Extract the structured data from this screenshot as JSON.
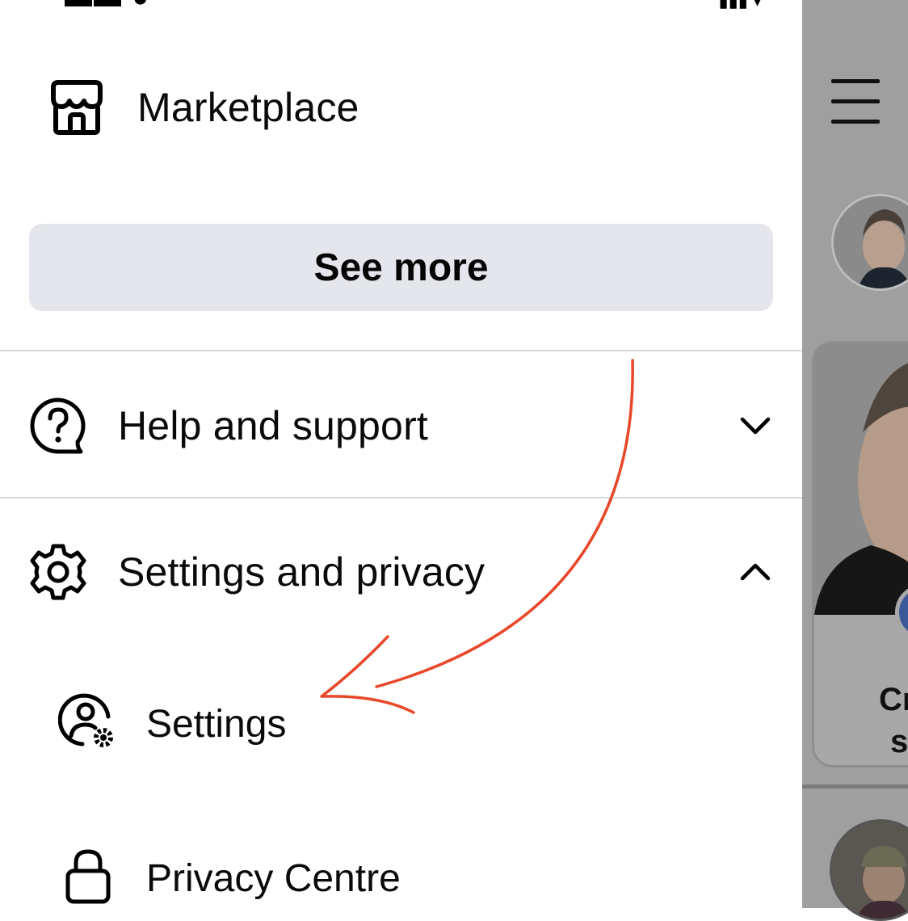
{
  "menu": {
    "marketplace": {
      "label": "Marketplace",
      "icon": "marketplace-icon"
    },
    "see_more": "See more",
    "help": {
      "label": "Help and support",
      "icon": "help-icon",
      "chevron": "chevron-down-icon"
    },
    "settings_privacy": {
      "label": "Settings and privacy",
      "icon": "gear-icon",
      "chevron": "chevron-up-icon"
    },
    "sub_items": [
      {
        "label": "Settings",
        "icon": "user-settings-icon"
      },
      {
        "label": "Privacy Centre",
        "icon": "lock-icon"
      }
    ]
  },
  "annotation": {
    "arrow_color": "#e8472a",
    "icon": "hand-drawn-arrow"
  },
  "background_page": {
    "story_text_line1": "Cr",
    "story_text_line2": "s"
  },
  "colors": {
    "button_bg": "#e4e6eb",
    "overlay": "#9f9f9f",
    "divider": "#d5d7da",
    "text": "#0a0a0a"
  }
}
